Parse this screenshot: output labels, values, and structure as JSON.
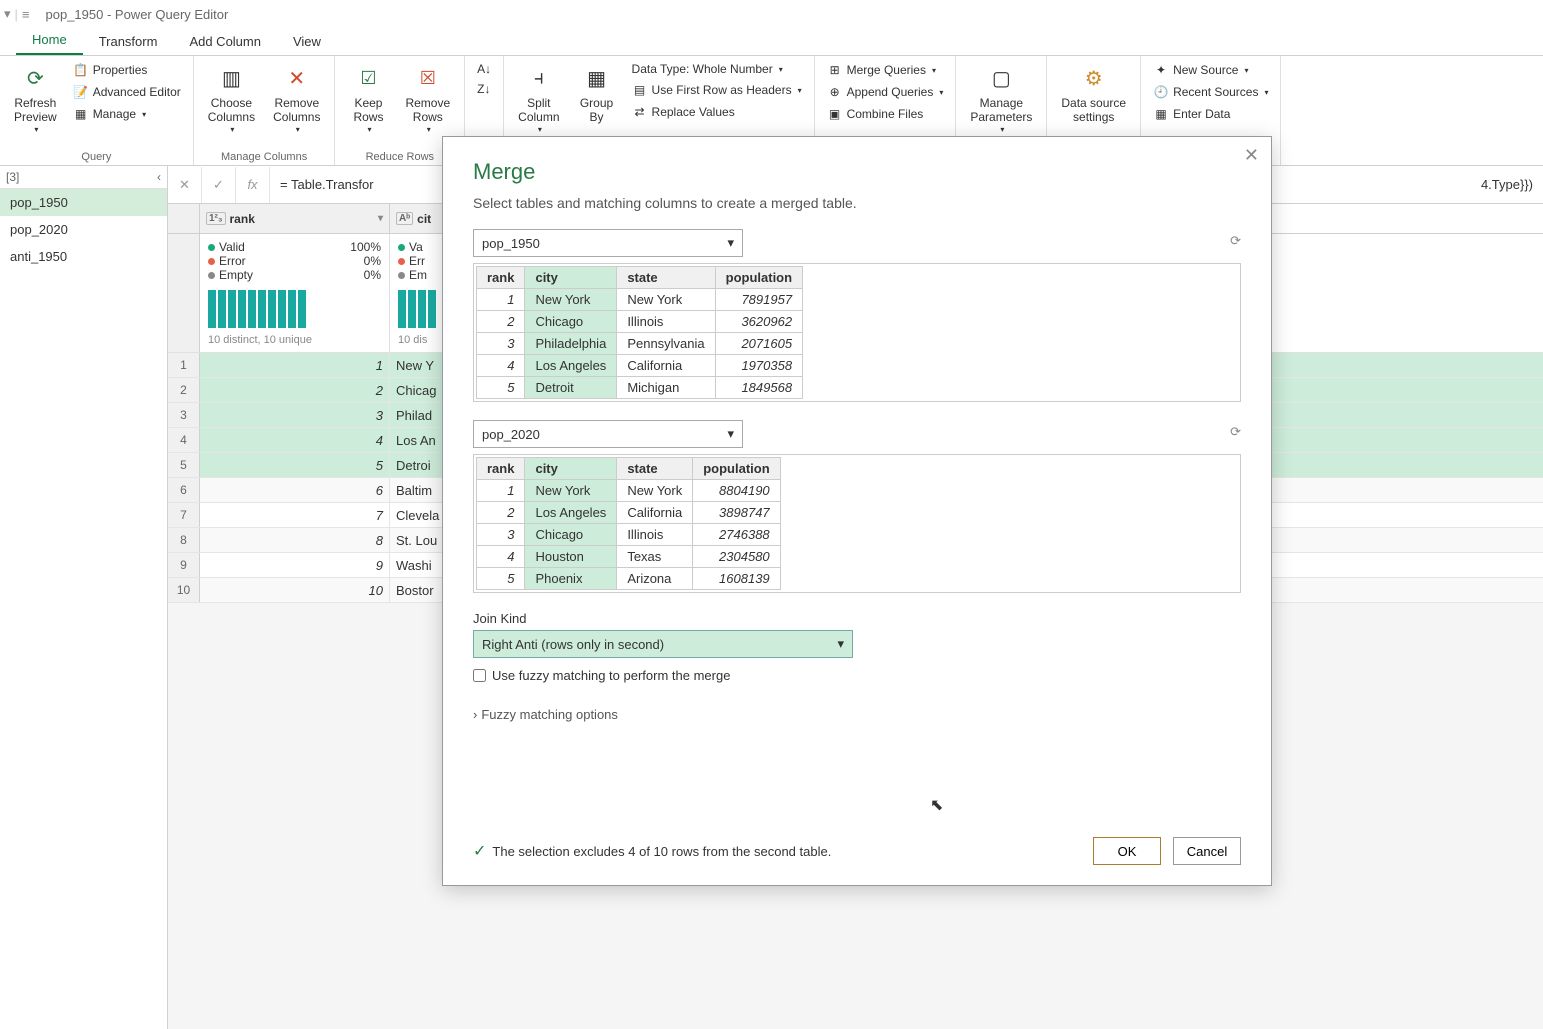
{
  "title": "pop_1950 - Power Query Editor",
  "tabs": {
    "home": "Home",
    "transform": "Transform",
    "addcol": "Add Column",
    "view": "View"
  },
  "ribbon": {
    "refresh": "Refresh\nPreview",
    "properties": "Properties",
    "advEditor": "Advanced Editor",
    "manage": "Manage",
    "choose": "Choose\nColumns",
    "remove": "Remove\nColumns",
    "keep": "Keep\nRows",
    "removeRows": "Remove\nRows",
    "split": "Split\nColumn",
    "group": "Group\nBy",
    "dtype": "Data Type: Whole Number",
    "firstRow": "Use First Row as Headers",
    "replace": "Replace Values",
    "mergeQ": "Merge Queries",
    "appendQ": "Append Queries",
    "combine": "Combine Files",
    "manageParam": "Manage\nParameters",
    "dataSource": "Data source\nsettings",
    "newSource": "New Source",
    "recentSrc": "Recent Sources",
    "enterData": "Enter Data",
    "grp_query": "Query",
    "grp_mc": "Manage Columns",
    "grp_rr": "Reduce Rows"
  },
  "queries": {
    "header": "[3]",
    "items": [
      "pop_1950",
      "pop_2020",
      "anti_1950"
    ],
    "selected": 0
  },
  "formula": {
    "left": "= Table.Transfor",
    "right": "4.Type}})"
  },
  "preview": {
    "col_rank": "rank",
    "col_city": "cit",
    "stats": {
      "valid": "Valid",
      "error": "Error",
      "empty": "Empty",
      "p100": "100%",
      "p0": "0%",
      "distinct": "10 distinct, 10 unique",
      "distinct2": "10 dis"
    },
    "rows": [
      {
        "n": 1,
        "rank": "1",
        "city": "New Y"
      },
      {
        "n": 2,
        "rank": "2",
        "city": "Chicag"
      },
      {
        "n": 3,
        "rank": "3",
        "city": "Philad"
      },
      {
        "n": 4,
        "rank": "4",
        "city": "Los An"
      },
      {
        "n": 5,
        "rank": "5",
        "city": "Detroi"
      },
      {
        "n": 6,
        "rank": "6",
        "city": "Baltim"
      },
      {
        "n": 7,
        "rank": "7",
        "city": "Clevela"
      },
      {
        "n": 8,
        "rank": "8",
        "city": "St. Lou"
      },
      {
        "n": 9,
        "rank": "9",
        "city": "Washi"
      },
      {
        "n": 10,
        "rank": "10",
        "city": "Bostor"
      }
    ]
  },
  "merge": {
    "title": "Merge",
    "subtitle": "Select tables and matching columns to create a merged table.",
    "table1_name": "pop_1950",
    "table2_name": "pop_2020",
    "headers": {
      "rank": "rank",
      "city": "city",
      "state": "state",
      "pop": "population"
    },
    "table1": [
      {
        "rank": 1,
        "city": "New York",
        "state": "New York",
        "pop": 7891957
      },
      {
        "rank": 2,
        "city": "Chicago",
        "state": "Illinois",
        "pop": 3620962
      },
      {
        "rank": 3,
        "city": "Philadelphia",
        "state": "Pennsylvania",
        "pop": 2071605
      },
      {
        "rank": 4,
        "city": "Los Angeles",
        "state": "California",
        "pop": 1970358
      },
      {
        "rank": 5,
        "city": "Detroit",
        "state": "Michigan",
        "pop": 1849568
      }
    ],
    "table2": [
      {
        "rank": 1,
        "city": "New York",
        "state": "New York",
        "pop": 8804190
      },
      {
        "rank": 2,
        "city": "Los Angeles",
        "state": "California",
        "pop": 3898747
      },
      {
        "rank": 3,
        "city": "Chicago",
        "state": "Illinois",
        "pop": 2746388
      },
      {
        "rank": 4,
        "city": "Houston",
        "state": "Texas",
        "pop": 2304580
      },
      {
        "rank": 5,
        "city": "Phoenix",
        "state": "Arizona",
        "pop": 1608139
      }
    ],
    "join_label": "Join Kind",
    "join_kind": "Right Anti (rows only in second)",
    "fuzzy_chk": "Use fuzzy matching to perform the merge",
    "fuzzy_opts": "Fuzzy matching options",
    "status": "The selection excludes 4 of 10 rows from the second table.",
    "ok": "OK",
    "cancel": "Cancel"
  }
}
